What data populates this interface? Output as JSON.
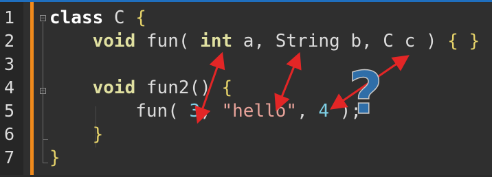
{
  "line_numbers": [
    "1",
    "2",
    "3",
    "4",
    "5",
    "6",
    "7"
  ],
  "code": {
    "l1": {
      "kw": "class",
      "name": " C ",
      "brace": "{"
    },
    "l2": {
      "indent": "    ",
      "kw": "void",
      "a": " fun( ",
      "kw2": "int",
      "b": " a, String b, C c ) ",
      "brace": "{ }"
    },
    "l4": {
      "indent": "    ",
      "kw": "void",
      "a": " fun2() ",
      "brace": "{"
    },
    "l5": {
      "indent": "        ",
      "a": "fun( ",
      "n1": "3",
      "c1": ", ",
      "s": "\"hello\"",
      "c2": ", ",
      "n2": "4",
      "end": " );"
    },
    "l6": {
      "indent": "    ",
      "brace": "}"
    },
    "l7": {
      "brace": "}"
    }
  },
  "annotation": {
    "symbol": "?",
    "arrow_color": "#e32626",
    "question_color": "#2f6ea8"
  },
  "colors": {
    "background": "#2f2f2f",
    "gutter": "#262626",
    "change_bar": "#f08a1c",
    "keyword": "#e0e0a0",
    "number": "#7fd0e6",
    "string": "#e8a39a",
    "brace": "#e6d36a"
  }
}
